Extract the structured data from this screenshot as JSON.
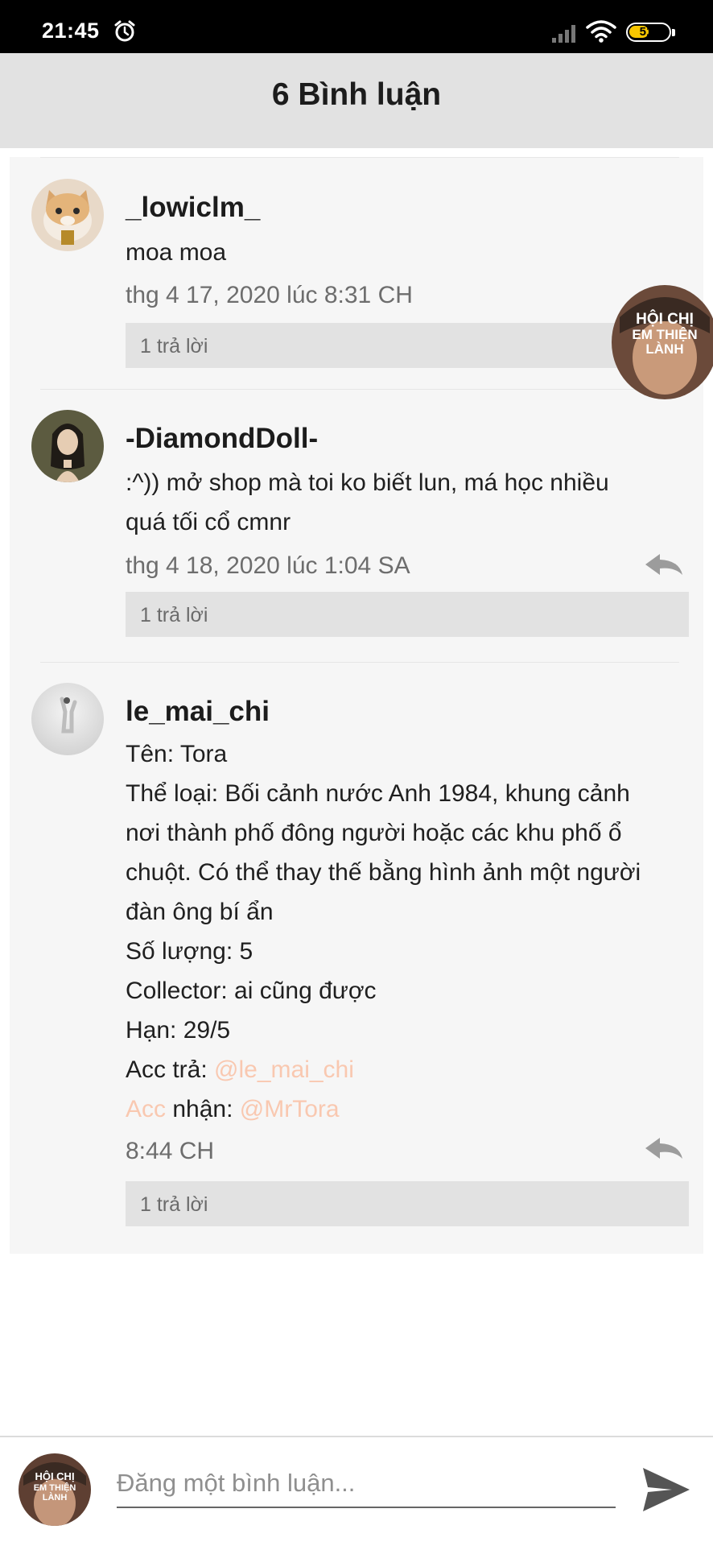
{
  "status_bar": {
    "time": "21:45",
    "battery": "51",
    "battery_level": 0.51,
    "icons": [
      "alarm-icon",
      "signal-icon",
      "wifi-icon",
      "battery-icon"
    ]
  },
  "header": {
    "title": "6 Bình luận"
  },
  "floating_bubble": {
    "lines": [
      "HỘI CHỊ",
      "EM THIỆN",
      "LÀNH"
    ]
  },
  "comments": [
    {
      "username": "_lowiclm_",
      "body": [
        "moa moa"
      ],
      "time": "thg 4 17, 2020 lúc 8:31 CH",
      "replies": "1 trả lời"
    },
    {
      "username": "-DiamondDoll-",
      "body": [
        ":^)) mở shop mà toi ko biết lun,  má học nhiều",
        "quá tối cổ cmnr"
      ],
      "time": "thg 4 18, 2020 lúc 1:04 SA",
      "replies": "1 trả lời"
    },
    {
      "username": "le_mai_chi",
      "body": [
        "Tên: Tora",
        "Thể loại: Bối cảnh nước Anh 1984, khung cảnh",
        "nơi thành phố đông người hoặc các khu phố ổ",
        "chuột. Có thể thay thế bằng hình ảnh một người",
        "đàn ông bí ẩn",
        "Số lượng: 5",
        "Collector: ai cũng được",
        "Hạn: 29/5"
      ],
      "acc_tra_label": "Acc trả: ",
      "acc_tra_mention": "@le_mai_chi",
      "acc_nhan_acc": "Acc",
      "acc_nhan_label": " nhận: ",
      "acc_nhan_mention": "@MrTora",
      "time": "8:44 CH",
      "replies": "1 trả lời"
    }
  ],
  "composer": {
    "placeholder": "Đăng một bình luận...",
    "avatar_lines": [
      "HỘI CHỊ",
      "EM THIỆN",
      "LÀNH"
    ]
  },
  "colors": {
    "header_bg": "#e2e2e2",
    "mention": "#f9c8b0",
    "reply_box": "#e2e2e2",
    "battery": "#f7c600"
  }
}
